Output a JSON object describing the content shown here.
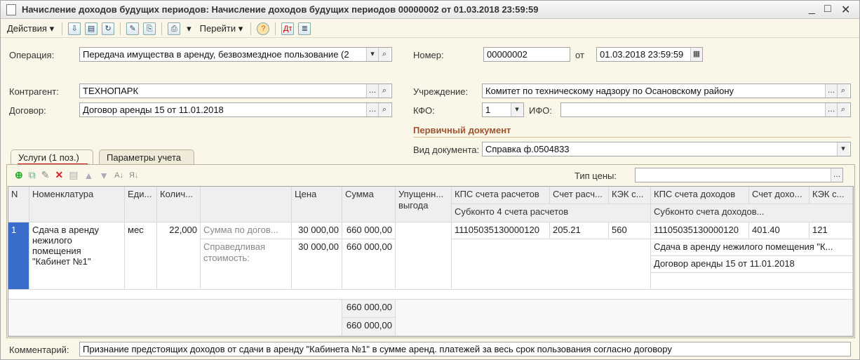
{
  "window": {
    "title": "Начисление доходов будущих периодов: Начисление доходов будущих периодов 00000002 от 01.03.2018 23:59:59"
  },
  "toolbar": {
    "actions_label": "Действия",
    "goto_label": "Перейти"
  },
  "header": {
    "operation_label": "Операция:",
    "operation_value": "Передача имущества в аренду, безвозмездное пользование (2",
    "number_label": "Номер:",
    "number_value": "00000002",
    "from_label": "от",
    "date_value": "01.03.2018 23:59:59",
    "counterparty_label": "Контрагент:",
    "counterparty_value": "ТЕХНОПАРК",
    "contract_label": "Договор:",
    "contract_value": "Договор аренды 15 от 11.01.2018",
    "institution_label": "Учреждение:",
    "institution_value": "Комитет по техническому надзору по Осановскому району",
    "kfo_label": "КФО:",
    "kfo_value": "1",
    "ifo_label": "ИФО:",
    "ifo_value": "",
    "primary_doc_title": "Первичный документ",
    "doc_type_label": "Вид документа:",
    "doc_type_value": "Справка ф.0504833"
  },
  "tabs": [
    {
      "label": "Услуги (1 поз.)"
    },
    {
      "label": "Параметры учета"
    }
  ],
  "price_type_label": "Тип цены:",
  "table": {
    "headers": {
      "n": "N",
      "nom": "Номенклатура",
      "unit": "Еди...",
      "qty": "Колич...",
      "price": "Цена",
      "sum": "Сумма",
      "lost": "Упущенн... выгода",
      "kps_calc": "КПС счета расчетов",
      "acc_calc": "Счет расч...",
      "kek_calc": "КЭК с...",
      "kps_inc": "КПС счета доходов",
      "acc_inc": "Счет дохо...",
      "kek_inc": "КЭК с...",
      "sub_calc": "Субконто 4 счета расчетов",
      "sub_inc": "Субконто счета доходов..."
    },
    "row": {
      "n": "1",
      "nom": "Сдача в аренду нежилого помещения \"Кабинет №1\"",
      "unit": "мес",
      "qty": "22,000",
      "kind1": "Сумма по догов...",
      "price1": "30 000,00",
      "sum1": "660 000,00",
      "kind2": "Справедливая стоимость:",
      "price2": "30 000,00",
      "sum2": "660 000,00",
      "kps_calc": "11105035130000120",
      "acc_calc": "205.21",
      "kek_calc": "560",
      "kps_inc": "11105035130000120",
      "acc_inc": "401.40",
      "kek_inc": "121",
      "sub_inc_1": "Сдача в аренду нежилого помещения \"К...",
      "sub_inc_2": "Договор аренды 15 от 11.01.2018"
    },
    "total1": "660 000,00",
    "total2": "660 000,00"
  },
  "comment": {
    "label": "Комментарий:",
    "value": "Признание предстоящих доходов от сдачи в аренду \"Кабинета №1\" в сумме аренд. платежей за весь срок пользования согласно договору"
  }
}
